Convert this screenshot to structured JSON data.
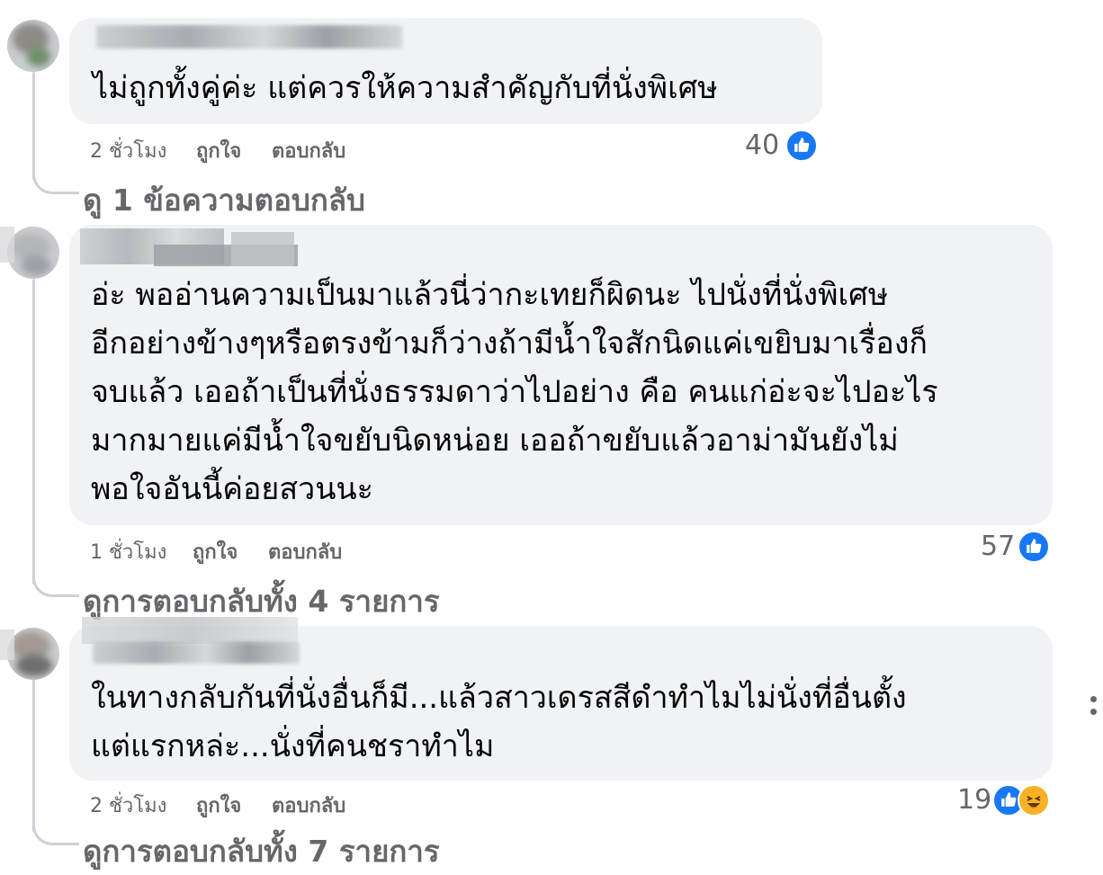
{
  "comments": [
    {
      "text_lines": [
        "ไม่ถูกทั้งคู่ค่ะ แต่ควรให้ความสำคัญกับที่นั่งพิเศษ"
      ],
      "time": "2 ชั่วโมง",
      "like_action": "ถูกใจ",
      "reply_action": "ตอบกลับ",
      "reaction_count": "40",
      "reactions": [
        "like-icon"
      ],
      "replies_label": "ดู 1 ข้อความตอบกลับ"
    },
    {
      "text_lines": [
        "อ่ะ พออ่านความเป็นมาแล้วนี่ว่ากะเทยก็ผิดนะ ไปนั่งที่นั่งพิเศษ",
        "อีกอย่างข้างๆหรือตรงข้ามก็ว่างถ้ามีน้ำใจสักนิดแค่เขยิบมาเรื่องก็",
        "จบแล้ว เออถ้าเป็นที่นั่งธรรมดาว่าไปอย่าง คือ คนแก่อ่ะจะไปอะไร",
        "มากมายแค่มีน้ำใจขยับนิดหน่อย เออถ้าขยับแล้วอาม่ามันยังไม่",
        "พอใจอันนี้ค่อยสวนนะ"
      ],
      "time": "1 ชั่วโมง",
      "like_action": "ถูกใจ",
      "reply_action": "ตอบกลับ",
      "reaction_count": "57",
      "reactions": [
        "like-icon"
      ],
      "replies_label": "ดูการตอบกลับทั้ง 4 รายการ"
    },
    {
      "text_lines": [
        "ในทางกลับกันที่นั่งอื่นก็มี...แล้วสาวเดรสสีดำทำไมไม่นั่งที่อื่นตั้ง",
        "แต่แรกหล่ะ...นั่งที่คนชราทำไม"
      ],
      "time": "2 ชั่วโมง",
      "like_action": "ถูกใจ",
      "reply_action": "ตอบกลับ",
      "reaction_count": "19",
      "reactions": [
        "like-icon",
        "haha-icon"
      ],
      "replies_label": "ดูการตอบกลับทั้ง 7 รายการ"
    }
  ],
  "colors": {
    "bubble": "#f0f2f5",
    "meta_text": "#65676b",
    "like_blue": "#1877f2",
    "thread_line": "#ced0d4"
  }
}
